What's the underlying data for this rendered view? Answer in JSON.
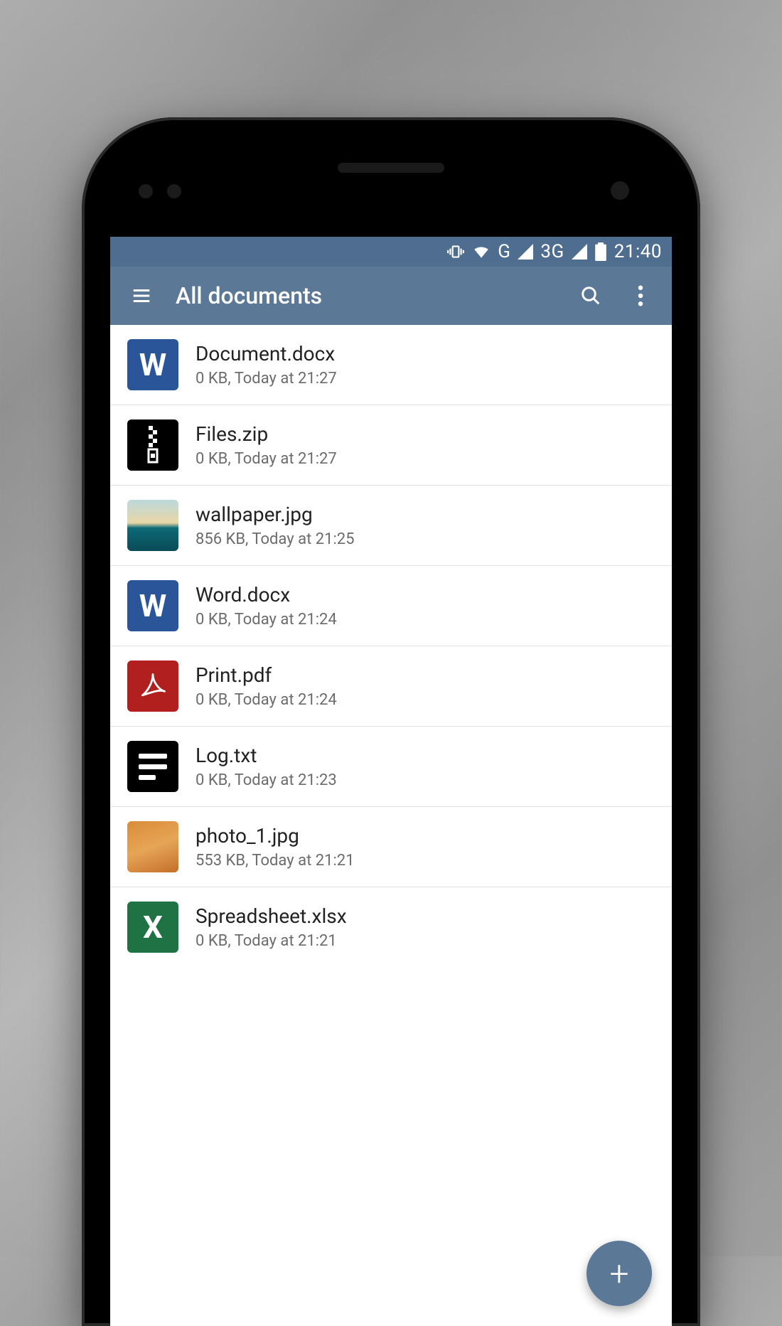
{
  "statusbar": {
    "network_g": "G",
    "network_3g": "3G",
    "time": "21:40"
  },
  "appbar": {
    "title": "All documents"
  },
  "files": [
    {
      "name": "Document.docx",
      "sub": "0 KB, Today at 21:27",
      "icon": "word",
      "letter": "W"
    },
    {
      "name": "Files.zip",
      "sub": "0 KB, Today at 21:27",
      "icon": "zip",
      "letter": ""
    },
    {
      "name": "wallpaper.jpg",
      "sub": "856 KB, Today at 21:25",
      "icon": "wall",
      "letter": ""
    },
    {
      "name": "Word.docx",
      "sub": "0 KB, Today at 21:24",
      "icon": "word",
      "letter": "W"
    },
    {
      "name": "Print.pdf",
      "sub": "0 KB, Today at 21:24",
      "icon": "pdf",
      "letter": ""
    },
    {
      "name": "Log.txt",
      "sub": "0 KB, Today at 21:23",
      "icon": "txt",
      "letter": ""
    },
    {
      "name": "photo_1.jpg",
      "sub": "553 KB, Today at 21:21",
      "icon": "photo",
      "letter": ""
    },
    {
      "name": "Spreadsheet.xlsx",
      "sub": "0 KB, Today at 21:21",
      "icon": "xls",
      "letter": "X"
    }
  ],
  "fab": {
    "label": "+"
  }
}
